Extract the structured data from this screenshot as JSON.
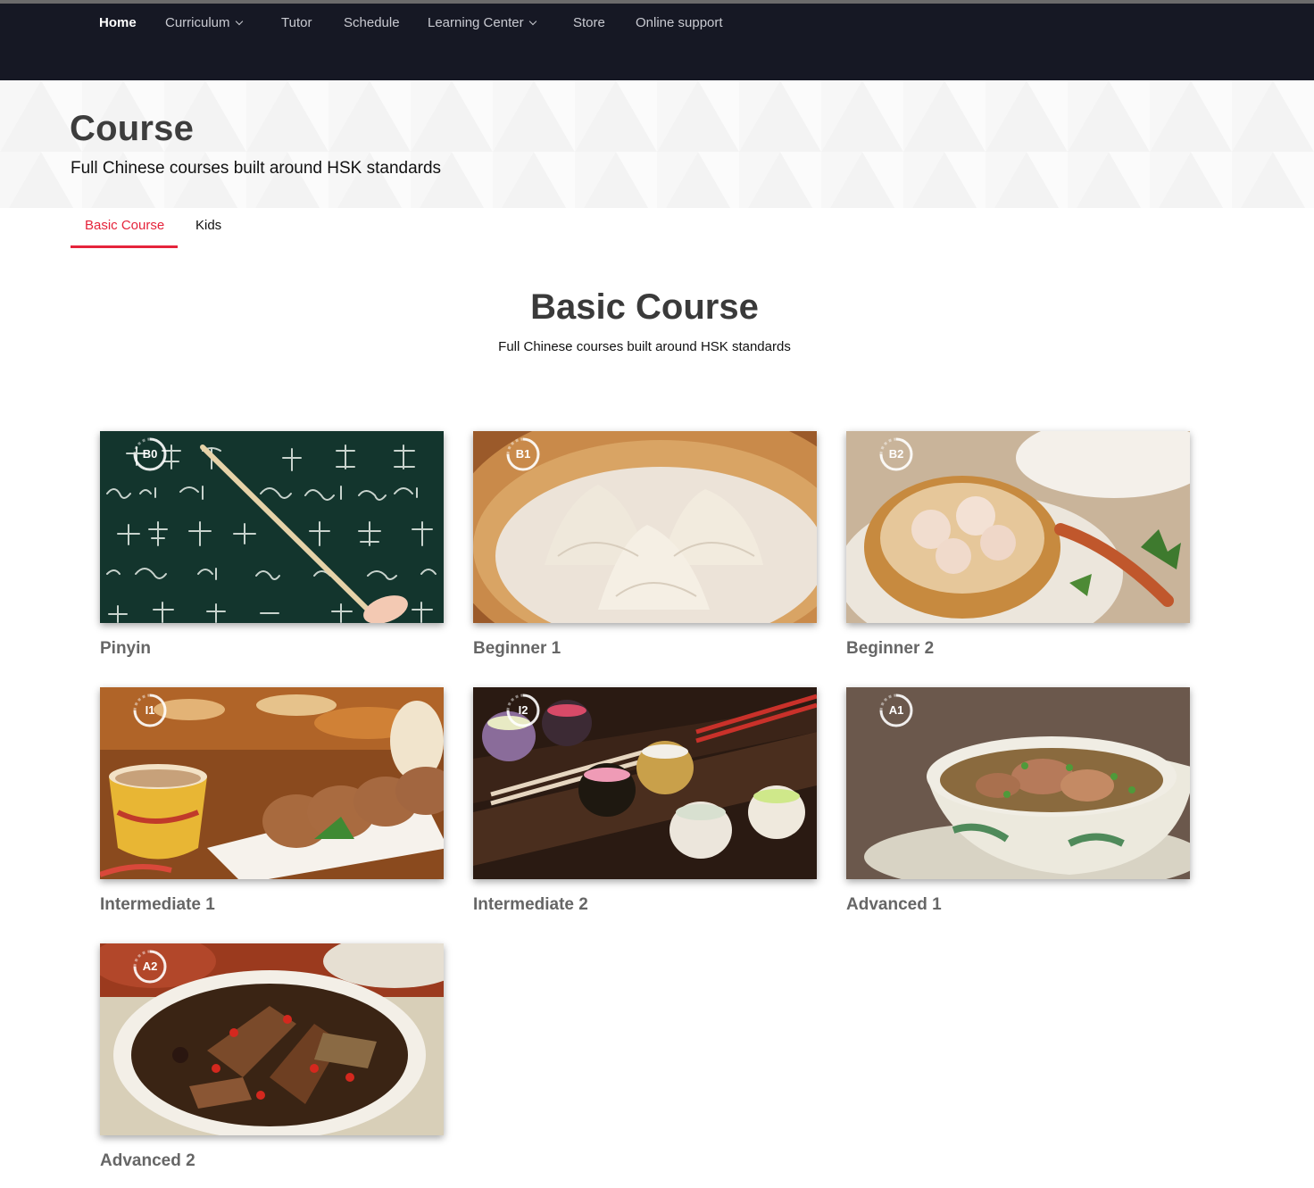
{
  "nav": {
    "items": [
      {
        "label": "Home",
        "dropdown": false,
        "active": true
      },
      {
        "label": "Curriculum",
        "dropdown": true,
        "active": false
      },
      {
        "label": "Tutor",
        "dropdown": false,
        "active": false
      },
      {
        "label": "Schedule",
        "dropdown": false,
        "active": false
      },
      {
        "label": "Learning Center",
        "dropdown": true,
        "active": false
      },
      {
        "label": "Store",
        "dropdown": false,
        "active": false
      },
      {
        "label": "Online support",
        "dropdown": false,
        "active": false
      }
    ]
  },
  "hero": {
    "title": "Course",
    "subtitle": "Full Chinese courses built around HSK standards"
  },
  "tabs": [
    {
      "label": "Basic Course",
      "active": true
    },
    {
      "label": "Kids",
      "active": false
    }
  ],
  "section": {
    "title": "Basic Course",
    "subtitle": "Full Chinese courses built around HSK standards"
  },
  "courses": [
    {
      "title": "Pinyin",
      "badge": "B0",
      "image": "chalkboard-pinyin-image"
    },
    {
      "title": "Beginner 1",
      "badge": "B1",
      "image": "steamed-dumplings-image"
    },
    {
      "title": "Beginner 2",
      "badge": "B2",
      "image": "dim-sum-image"
    },
    {
      "title": "Intermediate 1",
      "badge": "I1",
      "image": "tea-and-bread-image"
    },
    {
      "title": "Intermediate 2",
      "badge": "I2",
      "image": "sauce-bowls-chopsticks-image"
    },
    {
      "title": "Advanced 1",
      "badge": "A1",
      "image": "soup-bowl-image"
    },
    {
      "title": "Advanced 2",
      "badge": "A2",
      "image": "braised-meat-bowl-image"
    }
  ],
  "colors": {
    "navbar_bg": "#161824",
    "accent_red": "#e5233b",
    "heading_gray": "#3d3d3d",
    "card_title_gray": "#666666"
  }
}
